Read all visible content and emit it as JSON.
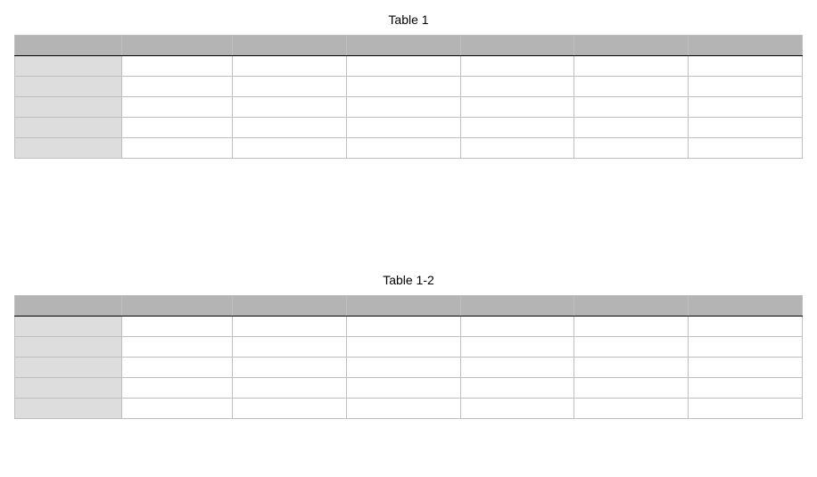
{
  "tables": [
    {
      "title": "Table 1",
      "headers": [
        "",
        "",
        "",
        "",
        "",
        "",
        ""
      ],
      "rows": [
        [
          "",
          "",
          "",
          "",
          "",
          "",
          ""
        ],
        [
          "",
          "",
          "",
          "",
          "",
          "",
          ""
        ],
        [
          "",
          "",
          "",
          "",
          "",
          "",
          ""
        ],
        [
          "",
          "",
          "",
          "",
          "",
          "",
          ""
        ],
        [
          "",
          "",
          "",
          "",
          "",
          "",
          ""
        ]
      ]
    },
    {
      "title": "Table 1-2",
      "headers": [
        "",
        "",
        "",
        "",
        "",
        "",
        ""
      ],
      "rows": [
        [
          "",
          "",
          "",
          "",
          "",
          "",
          ""
        ],
        [
          "",
          "",
          "",
          "",
          "",
          "",
          ""
        ],
        [
          "",
          "",
          "",
          "",
          "",
          "",
          ""
        ],
        [
          "",
          "",
          "",
          "",
          "",
          "",
          ""
        ],
        [
          "",
          "",
          "",
          "",
          "",
          "",
          ""
        ]
      ]
    }
  ]
}
